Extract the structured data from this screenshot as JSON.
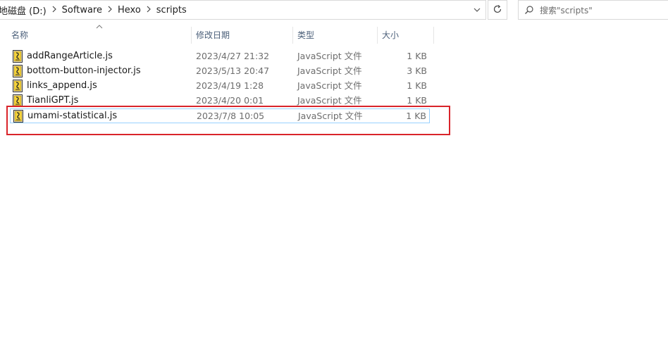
{
  "address_bar": {
    "crumbs": [
      "地磁盘 (D:)",
      "Software",
      "Hexo",
      "scripts"
    ],
    "dropdown_icon": "chevron-down-icon",
    "refresh_icon": "refresh-icon"
  },
  "search": {
    "placeholder": "搜索\"scripts\"",
    "icon": "search-icon"
  },
  "columns": {
    "name": "名称",
    "date": "修改日期",
    "type": "类型",
    "size": "大小"
  },
  "files": [
    {
      "name": "addRangeArticle.js",
      "date": "2023/4/27 21:32",
      "type": "JavaScript 文件",
      "size": "1 KB"
    },
    {
      "name": "bottom-button-injector.js",
      "date": "2023/5/13 20:47",
      "type": "JavaScript 文件",
      "size": "3 KB"
    },
    {
      "name": "links_append.js",
      "date": "2023/4/19 1:28",
      "type": "JavaScript 文件",
      "size": "1 KB"
    },
    {
      "name": "TianliGPT.js",
      "date": "2023/4/20 0:01",
      "type": "JavaScript 文件",
      "size": "1 KB"
    },
    {
      "name": "umami-statistical.js",
      "date": "2023/7/8 10:05",
      "type": "JavaScript 文件",
      "size": "1 KB"
    }
  ],
  "selected_file_index": 4,
  "colors": {
    "highlight_border": "#d9242b",
    "selection_border": "#99d1ff",
    "header_text": "#4c607a"
  }
}
